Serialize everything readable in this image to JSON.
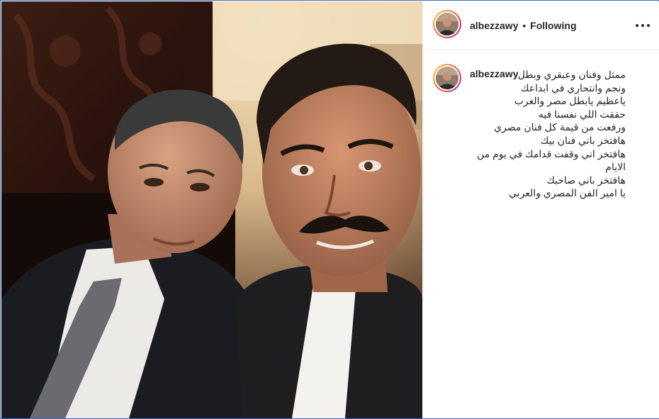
{
  "post": {
    "username": "albezzawy",
    "separator": "•",
    "follow_state": "Following"
  },
  "caption": {
    "username": "albezzawy",
    "lines": [
      "ممثل وفنان وعبقري وبطل",
      "ونجم وانتحاري في ابداعك",
      "ياعظيم يابطل مصر والعرب",
      "حققت اللي نفسنا فيه",
      "ورفعت من قيمة كل فنان مصري",
      "هافتخر باني فنان بيك",
      "هافتخر اني وقفت قدامك في يوم من",
      "الايام",
      "هافتخر باني صاحبك",
      "يا امير الفن المصري والعربي"
    ]
  },
  "icons": {
    "more": "more-options-icon",
    "avatar_ring": "story-ring"
  },
  "colors": {
    "frame_border": "#3d6fb8",
    "text": "#262626",
    "divider": "#efefef"
  }
}
